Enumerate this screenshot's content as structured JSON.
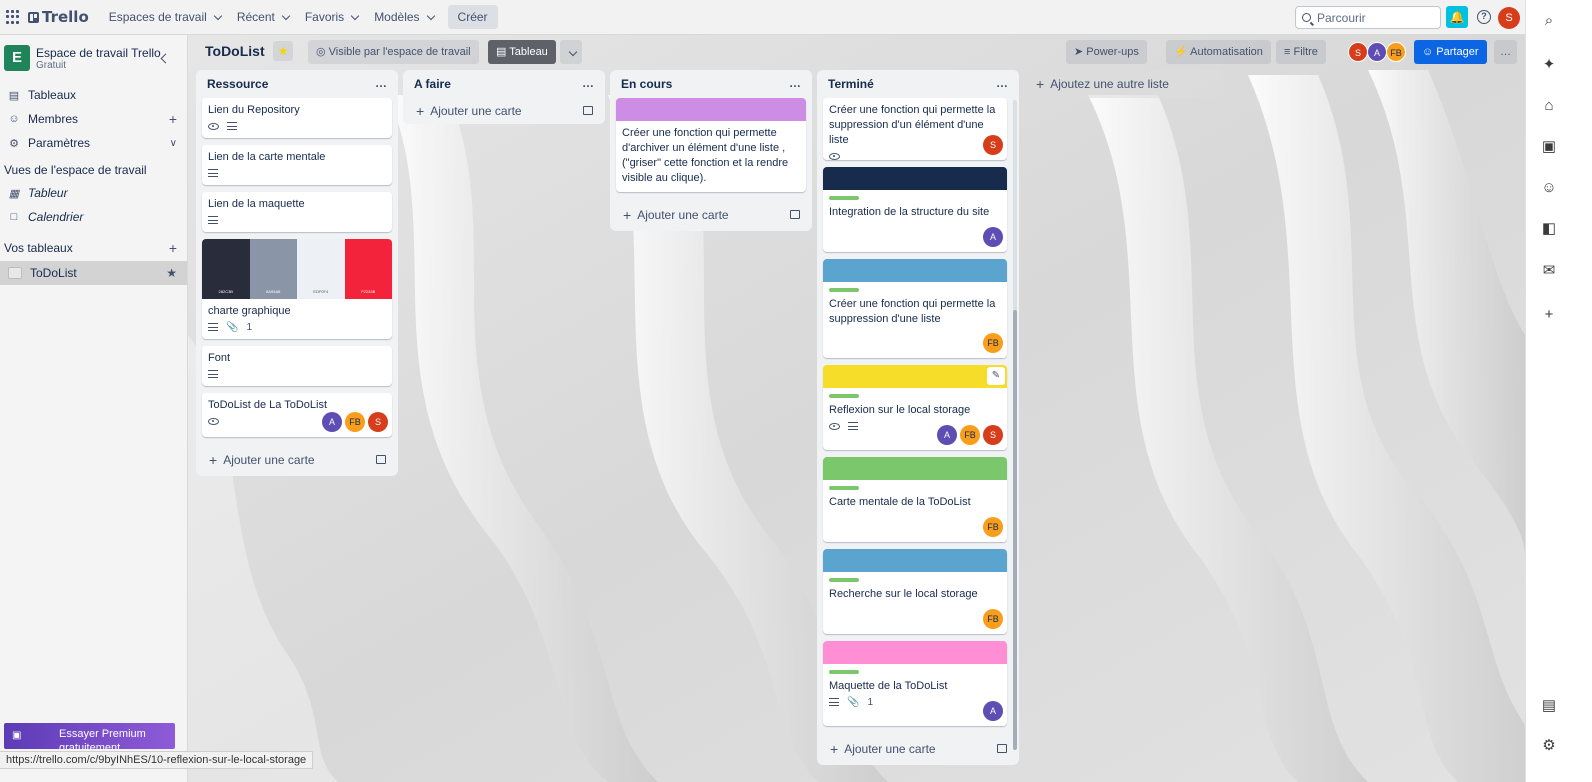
{
  "topnav": {
    "logo": "Trello",
    "menus": [
      "Espaces de travail",
      "Récent",
      "Favoris",
      "Modèles"
    ],
    "create_label": "Créer",
    "search_placeholder": "Parcourir",
    "help": "?",
    "user_initial": "S"
  },
  "sidebar": {
    "workspace_initial": "E",
    "workspace_name": "Espace de travail Trello",
    "workspace_plan": "Gratuit",
    "items": [
      {
        "label": "Tableaux",
        "icon": "board-icon"
      },
      {
        "label": "Membres",
        "icon": "person-icon"
      },
      {
        "label": "Paramètres",
        "icon": "gear-icon"
      }
    ],
    "views_title": "Vues de l'espace de travail",
    "views": [
      {
        "label": "Tableur",
        "icon": "table-icon"
      },
      {
        "label": "Calendrier",
        "icon": "calendar-icon"
      }
    ],
    "boards_title": "Vos tableaux",
    "boards": [
      {
        "label": "ToDoList"
      }
    ],
    "premium_label": "Essayer Premium gratuitement"
  },
  "board": {
    "title": "ToDoList",
    "visibility_label": "Visible par l'espace de travail",
    "view_label": "Tableau",
    "powerups_label": "Power-ups",
    "automation_label": "Automatisation",
    "filter_label": "Filtre",
    "share_label": "Partager",
    "members": [
      "S",
      "A",
      "FB"
    ],
    "add_list_label": "Ajoutez une autre liste"
  },
  "lists": [
    {
      "title": "Ressource",
      "add_card_label": "Ajouter une carte",
      "cards": [
        {
          "title": "Lien du Repository",
          "badges": [
            "watch",
            "description"
          ],
          "members": []
        },
        {
          "title": "Lien de la carte mentale",
          "badges": [
            "description"
          ],
          "members": []
        },
        {
          "title": "Lien de la maquette",
          "badges": [
            "description"
          ],
          "members": []
        },
        {
          "title": "charte graphique",
          "badges": [
            "description",
            "attachment"
          ],
          "attachments": "1",
          "members": [],
          "swatches": [
            {
              "color": "#282C3B",
              "label": "282C3B"
            },
            {
              "color": "#8A95A8",
              "label": "8A95A8"
            },
            {
              "color": "#EDF0F4",
              "label": "EDF0F4"
            },
            {
              "color": "#F2233B",
              "label": "F2233B"
            }
          ]
        },
        {
          "title": "Font",
          "badges": [
            "description"
          ],
          "members": []
        },
        {
          "title": "ToDoList de La ToDoList",
          "badges": [
            "watch"
          ],
          "members": [
            "A",
            "FB",
            "S"
          ]
        }
      ]
    },
    {
      "title": "A faire",
      "add_card_label": "Ajouter une carte",
      "cards": []
    },
    {
      "title": "En cours",
      "add_card_label": "Ajouter une carte",
      "cards": [
        {
          "title": "Créer une fonction qui permette d'archiver un élément d'une liste , (\"griser\" cette fonction et la rendre visible au clique).",
          "cover": "#cd8de5",
          "badges": [],
          "members": []
        }
      ]
    },
    {
      "title": "Terminé",
      "add_card_label": "Ajouter une carte",
      "cards": [
        {
          "title": "Créer une fonction qui permette la suppression d'un élément d'une liste",
          "badges": [
            "watch"
          ],
          "members": [
            "S"
          ]
        },
        {
          "title": "Integration de la structure du site",
          "cover": "#172b4d",
          "label": true,
          "badges": [],
          "members": [
            "A"
          ]
        },
        {
          "title": "Créer une fonction qui permette la suppression d'une liste",
          "cover": "#5ba4cf",
          "label": true,
          "badges": [],
          "members": [
            "FB"
          ]
        },
        {
          "title": "Reflexion sur le local storage",
          "cover": "#f5dd29",
          "label": true,
          "badges": [
            "watch",
            "description"
          ],
          "members": [
            "A",
            "FB",
            "S"
          ],
          "hovered": true
        },
        {
          "title": "Carte mentale de la ToDoList",
          "cover": "#7bc86c",
          "label": true,
          "badges": [],
          "members": [
            "FB"
          ]
        },
        {
          "title": "Recherche sur le local storage",
          "cover": "#5ba4cf",
          "label": true,
          "badges": [],
          "members": [
            "FB"
          ]
        },
        {
          "title": "Maquette de la ToDoList",
          "cover": "#ff8ed4",
          "label": true,
          "badges": [
            "description",
            "attachment"
          ],
          "attachments": "1",
          "members": [
            "A"
          ]
        }
      ]
    }
  ],
  "status_url": "https://trello.com/c/9byINhES/10-reflexion-sur-le-local-storage",
  "colors": {
    "accent": "#0c66e4",
    "label_green": "#7bc86c",
    "avatar_red": "#d63d1a",
    "avatar_purple": "#5e4db2",
    "avatar_orange": "#f99e1a"
  }
}
